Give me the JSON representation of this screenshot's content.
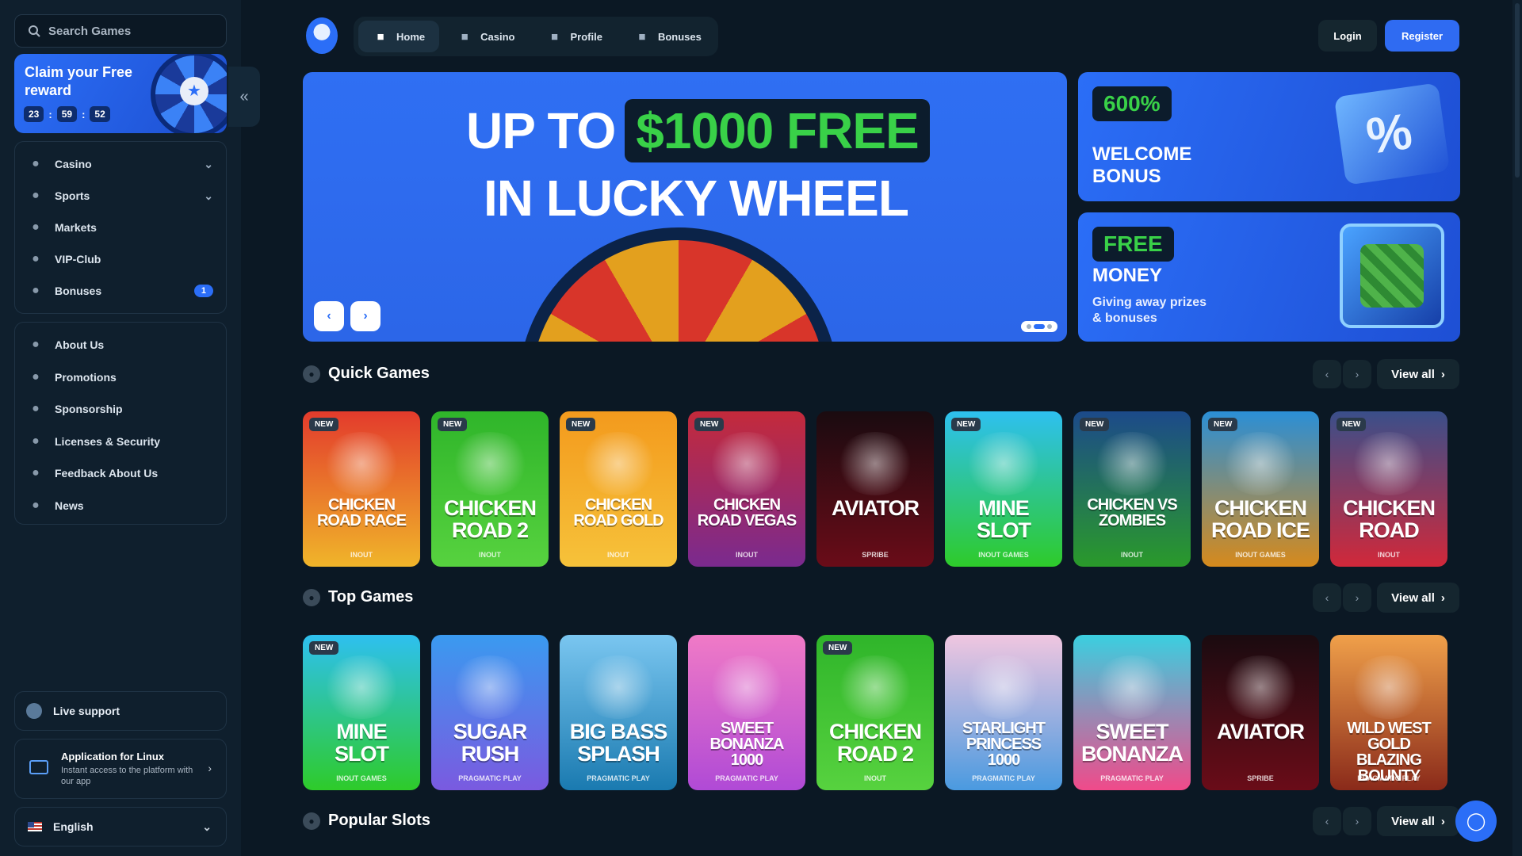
{
  "sidebar": {
    "search_placeholder": "Search Games",
    "claim": {
      "title": "Claim your Free reward",
      "timer": [
        "23",
        "59",
        "52"
      ]
    },
    "nav_main": [
      {
        "label": "Casino",
        "icon": "casino-chip-icon",
        "chevron": true
      },
      {
        "label": "Sports",
        "icon": "globe-ball-icon",
        "chevron": true
      },
      {
        "label": "Markets",
        "icon": "candlestick-icon"
      },
      {
        "label": "VIP-Club",
        "icon": "crown-icon"
      },
      {
        "label": "Bonuses",
        "icon": "gift-icon",
        "badge": "1"
      }
    ],
    "nav_info": [
      {
        "label": "About Us",
        "icon": "book-icon"
      },
      {
        "label": "Promotions",
        "icon": "ticket-icon"
      },
      {
        "label": "Sponsorship",
        "icon": "medal-icon"
      },
      {
        "label": "Licenses & Security",
        "icon": "shield-icon"
      },
      {
        "label": "Feedback About Us",
        "icon": "chat-bubble-icon"
      },
      {
        "label": "News",
        "icon": "newspaper-icon"
      }
    ],
    "live_support": "Live support",
    "app": {
      "title": "Application for Linux",
      "subtitle": "Instant access to the platform with our app"
    },
    "language": "English"
  },
  "header": {
    "tabs": [
      {
        "label": "Home",
        "icon": "home-icon",
        "active": true
      },
      {
        "label": "Casino",
        "icon": "casino-chip-icon"
      },
      {
        "label": "Profile",
        "icon": "user-icon"
      },
      {
        "label": "Bonuses",
        "icon": "gift-icon"
      }
    ],
    "login": "Login",
    "register": "Register"
  },
  "hero": {
    "line1_prefix": "UP TO",
    "line1_highlight": "$1000 FREE",
    "line2": "IN LUCKY WHEEL"
  },
  "promos": [
    {
      "pill": "600%",
      "title": "WELCOME BONUS",
      "subtitle": ""
    },
    {
      "pill": "FREE",
      "title": "MONEY",
      "subtitle": "Giving away prizes & bonuses"
    }
  ],
  "sections": [
    {
      "title": "Quick Games",
      "icon": "dice-icon",
      "view_all": "View all",
      "cards": [
        {
          "name": "CHICKEN ROAD RACE",
          "provider": "INOUT",
          "new": true,
          "bg": "#e33b2c",
          "bg2": "#f0b52a"
        },
        {
          "name": "CHICKEN ROAD 2",
          "provider": "INOUT",
          "new": true,
          "bg": "#2fb52a",
          "bg2": "#57d23f"
        },
        {
          "name": "CHICKEN ROAD GOLD",
          "provider": "INOUT",
          "new": true,
          "bg": "#f39a1d",
          "bg2": "#f6c23a"
        },
        {
          "name": "CHICKEN ROAD VEGAS",
          "provider": "INOUT",
          "new": true,
          "bg": "#c42a3b",
          "bg2": "#7a2a8f"
        },
        {
          "name": "AVIATOR",
          "provider": "SPRIBE",
          "new": false,
          "bg": "#1a0b10",
          "bg2": "#6a0c18"
        },
        {
          "name": "MINE SLOT",
          "provider": "INOUT GAMES",
          "new": true,
          "bg": "#2ec0f0",
          "bg2": "#2ecb2a"
        },
        {
          "name": "CHICKEN VS ZOMBIES",
          "provider": "INOUT",
          "new": true,
          "bg": "#1c4a8a",
          "bg2": "#2a9a2a"
        },
        {
          "name": "CHICKEN ROAD ICE",
          "provider": "INOUT GAMES",
          "new": true,
          "bg": "#2b8fd6",
          "bg2": "#d68a1c"
        },
        {
          "name": "CHICKEN ROAD",
          "provider": "INOUT",
          "new": true,
          "bg": "#3a4f8a",
          "bg2": "#d1283a"
        }
      ]
    },
    {
      "title": "Top Games",
      "icon": "flame-icon",
      "view_all": "View all",
      "cards": [
        {
          "name": "MINE SLOT",
          "provider": "INOUT GAMES",
          "new": true,
          "bg": "#2ec0f0",
          "bg2": "#2ecb2a"
        },
        {
          "name": "SUGAR RUSH",
          "provider": "PRAGMATIC PLAY",
          "new": false,
          "bg": "#3a9af0",
          "bg2": "#7a5ae0"
        },
        {
          "name": "BIG BASS SPLASH",
          "provider": "PRAGMATIC PLAY",
          "new": false,
          "bg": "#7ac6f0",
          "bg2": "#1a7ab0"
        },
        {
          "name": "SWEET BONANZA 1000",
          "provider": "PRAGMATIC PLAY",
          "new": false,
          "bg": "#f07ac6",
          "bg2": "#b04ad6"
        },
        {
          "name": "CHICKEN ROAD 2",
          "provider": "INOUT",
          "new": true,
          "bg": "#2fb52a",
          "bg2": "#57d23f"
        },
        {
          "name": "STARLIGHT PRINCESS 1000",
          "provider": "PRAGMATIC PLAY",
          "new": false,
          "bg": "#f0c6e0",
          "bg2": "#4a9ae0"
        },
        {
          "name": "SWEET BONANZA",
          "provider": "PRAGMATIC PLAY",
          "new": false,
          "bg": "#3acfe0",
          "bg2": "#f04a8a"
        },
        {
          "name": "AVIATOR",
          "provider": "SPRIBE",
          "new": false,
          "bg": "#1a0b10",
          "bg2": "#6a0c18"
        },
        {
          "name": "WILD WEST GOLD BLAZING BOUNTY",
          "provider": "PRAGMATIC PLAY",
          "new": false,
          "bg": "#f0a04a",
          "bg2": "#8a2a1a"
        }
      ]
    },
    {
      "title": "Popular Slots",
      "icon": "reels-icon",
      "view_all": "View all",
      "cards": []
    }
  ],
  "colors": {
    "accent": "#2b6ef7",
    "bg": "#0b1824",
    "sidebar": "#0f1f2d",
    "green": "#39d148"
  }
}
